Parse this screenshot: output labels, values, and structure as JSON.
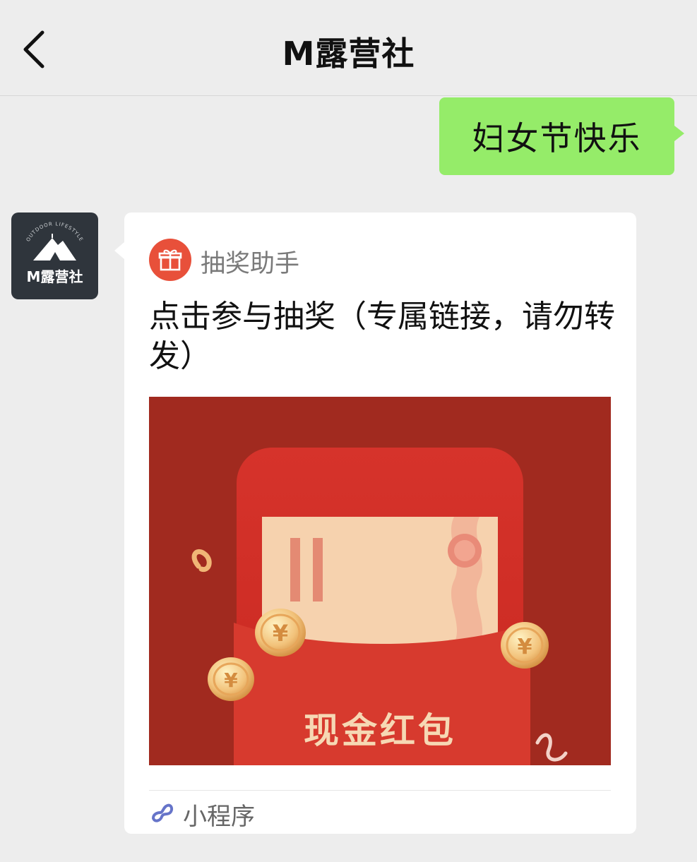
{
  "header": {
    "title": "M露营社"
  },
  "messages": {
    "outgoing": {
      "text": "妇女节快乐"
    },
    "incoming": {
      "avatar_text": "M露营社",
      "avatar_arc_text": "OUTDOOR LIFESTYLE",
      "card": {
        "source_name": "抽奖助手",
        "title": "点击参与抽奖（专属链接，请勿转发）",
        "cover_text": "现金红包",
        "footer_label": "小程序"
      }
    }
  },
  "icons": [
    "back-arrow-icon",
    "gift-icon",
    "mini-program-icon",
    "coin-icon"
  ],
  "colors": {
    "outgoing_bubble": "#95ec69",
    "background": "#ededed",
    "gift_badge": "#e8503a",
    "red_packet": "#c72a22",
    "mini_program": "#6674c9"
  }
}
